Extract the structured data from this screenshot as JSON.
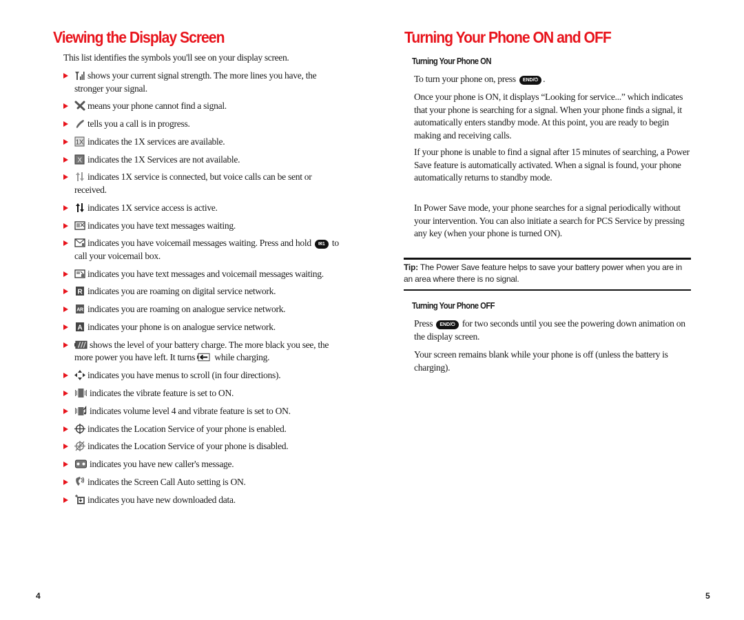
{
  "left_page": {
    "title": "Viewing the Display Screen",
    "intro": "This list identifies the symbols you'll see on your display screen.",
    "items": [
      {
        "icon": "signal-strength-icon",
        "pre": "",
        "text": "shows your current signal strength. The more lines you have, the stronger your signal."
      },
      {
        "icon": "no-signal-icon",
        "pre": "",
        "text": "means your phone cannot find a signal."
      },
      {
        "icon": "call-in-progress-icon",
        "pre": "",
        "text": "tells you a call is in progress."
      },
      {
        "icon": "1x-available-icon",
        "pre": "",
        "text": "indicates the 1X services are available."
      },
      {
        "icon": "1x-unavailable-icon",
        "pre": "",
        "text": "indicates the 1X Services are not available."
      },
      {
        "icon": "1x-connected-icon",
        "pre": "",
        "text": "indicates 1X service is connected, but voice calls can be sent or received."
      },
      {
        "icon": "1x-active-icon",
        "pre": "",
        "text": "indicates 1X service access is active."
      },
      {
        "icon": "text-message-icon",
        "pre": "",
        "text": "indicates you have text messages waiting."
      },
      {
        "icon": "voicemail-icon",
        "pre": "",
        "text": "indicates you have voicemail messages waiting. Press and hold",
        "key": "✉1",
        "after": "to call your voicemail box."
      },
      {
        "icon": "text-and-voicemail-icon",
        "pre": "",
        "text": "indicates you have text messages and voicemail messages waiting."
      },
      {
        "icon": "roaming-digital-icon",
        "pre": "",
        "text": "indicates you are roaming on digital service network."
      },
      {
        "icon": "roaming-analogue-icon",
        "pre": "",
        "text": "indicates you are roaming on analogue service network."
      },
      {
        "icon": "analogue-network-icon",
        "pre": "",
        "text": "indicates your phone is on analogue service network."
      },
      {
        "icon": "battery-icon",
        "pre": "",
        "text": "shows the level of your battery charge. The more black you see, the more power you have left. It turns",
        "inline_icon": "charging-icon",
        "after": "while charging."
      },
      {
        "icon": "scroll-arrows-icon",
        "pre": "",
        "text": "indicates you have menus to scroll (in four directions)."
      },
      {
        "icon": "vibrate-icon",
        "pre": "",
        "text": "indicates the vibrate feature is set to ON."
      },
      {
        "icon": "volume-vibrate-icon",
        "pre": "",
        "text": "indicates volume level 4 and vibrate feature is set to ON."
      },
      {
        "icon": "location-on-icon",
        "pre": "",
        "text": "indicates the Location Service of your phone is enabled."
      },
      {
        "icon": "location-off-icon",
        "pre": "",
        "text": "indicates the Location Service of your phone is disabled."
      },
      {
        "icon": "caller-message-icon",
        "pre": "",
        "text": "indicates you have new caller's message."
      },
      {
        "icon": "screen-call-icon",
        "pre": "",
        "text": "indicates the Screen Call Auto setting is ON."
      },
      {
        "icon": "download-icon",
        "pre": "",
        "text": "indicates you have new downloaded data."
      }
    ],
    "page_number": "4"
  },
  "right_page": {
    "title": "Turning Your Phone ON and OFF",
    "on_section": {
      "heading": "Turning Your Phone ON",
      "p1_before": "To turn your phone on, press",
      "p1_key": "END/⏻",
      "p1_after": ".",
      "p2": "Once your phone is ON, it displays “Looking for service...” which indicates that your phone is searching for a signal. When your phone finds a signal, it automatically enters standby mode. At this point, you are ready to begin making and receiving calls.",
      "p3": "If your phone is unable to find a signal after 15 minutes of searching, a Power Save feature is automatically activated. When a signal is found, your phone automatically returns to standby mode.",
      "p4": "In Power Save mode, your phone searches for a signal periodically without your intervention. You can also initiate a search for PCS Service by pressing any key (when your phone is turned ON)."
    },
    "tip": {
      "label": "Tip:",
      "text": "The Power Save feature helps to save your battery power when you are in an area where there is no signal."
    },
    "off_section": {
      "heading": "Turning Your Phone OFF",
      "p1_before": "Press",
      "p1_key": "END/⏻",
      "p1_after": "for two seconds until you see the powering down animation on the display screen.",
      "p2": "Your screen remains blank while your phone is off (unless the battery is charging)."
    },
    "page_number": "5"
  },
  "colors": {
    "accent_red": "#e8141c",
    "text": "#1a1a1a",
    "rule": "#111111"
  }
}
